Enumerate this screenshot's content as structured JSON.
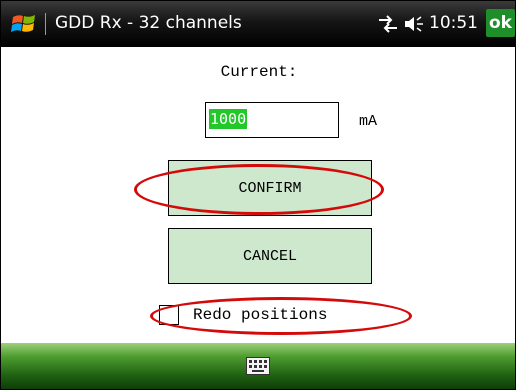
{
  "titlebar": {
    "title": "GDD Rx - 32 channels",
    "clock": "10:51",
    "ok_label": "ok",
    "start_icon": "windows-flag-icon",
    "connectivity_icon": "connectivity-icon",
    "volume_icon": "volume-icon"
  },
  "form": {
    "current_label": "Current:",
    "current_value": "1000",
    "unit": "mA",
    "confirm_label": "CONFIRM",
    "cancel_label": "CANCEL",
    "redo_label": "Redo positions",
    "redo_checked": false
  },
  "bottombar": {
    "keyboard_icon": "keyboard-icon"
  },
  "colors": {
    "button_bg": "#cde8cc",
    "highlight": "#22c82a",
    "annotation": "#d40a0a",
    "ok_bg": "#1e8e2a"
  }
}
